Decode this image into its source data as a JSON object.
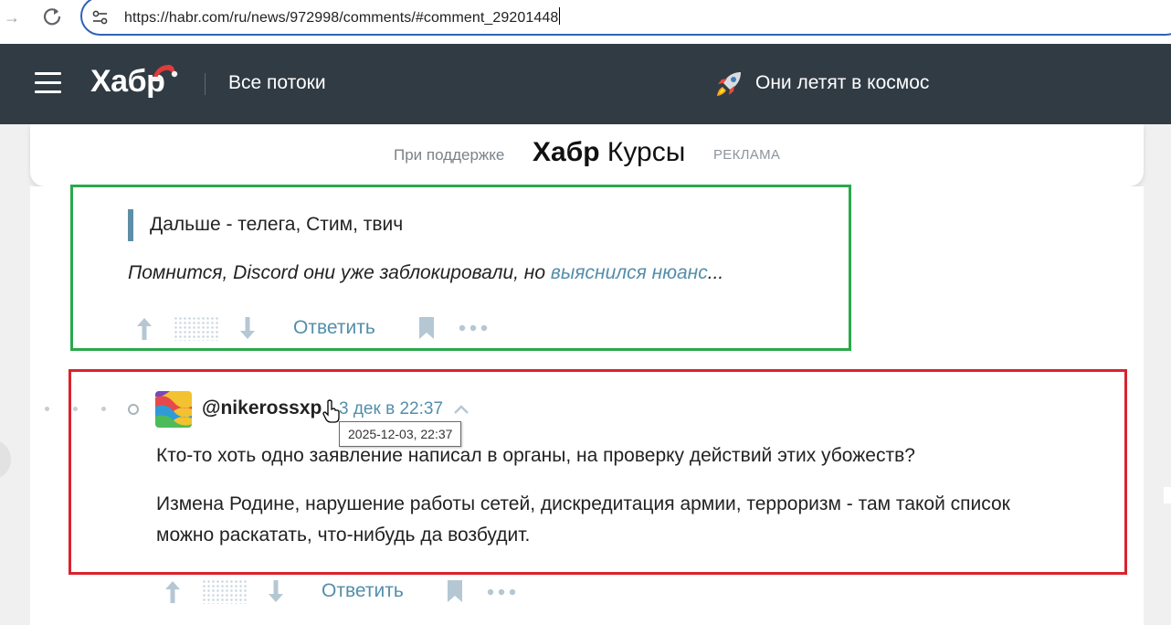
{
  "browser": {
    "url": "https://habr.com/ru/news/972998/comments/#comment_29201448"
  },
  "header": {
    "logo": "Хабр",
    "all_streams": "Все потоки",
    "promo_title": "Они летят в космос"
  },
  "sponsor": {
    "lead": "При поддержке",
    "brand_bold": "Хабр",
    "brand_regular": "Курсы",
    "ad_label": "РЕКЛАМА"
  },
  "comment1": {
    "quote": "Дальше - телега, Стим, твич",
    "text_before_link": "Помнится, Discord они уже заблокировали, но ",
    "link_text": "выяснился нюанс",
    "text_after_link": "...",
    "reply_label": "Ответить"
  },
  "comment2": {
    "username": "@nikerossxp",
    "time": "3 дек в 22:37",
    "tooltip": "2025-12-03, 22:37",
    "paragraph1": "Кто-то хоть одно заявление написал в органы, на проверку действий этих убожеств?",
    "paragraph2_line1": "Измена Родине, нарушение работы сетей, дискредитация армии, терроризм - там такой список",
    "paragraph2_line2": "можно раскатать, что-нибудь да возбудит.",
    "reply_label": "Ответить"
  },
  "colors": {
    "header_bg": "#303b44",
    "link": "#548eaa",
    "green_frame": "#2aa84a",
    "red_frame": "#d9232e"
  }
}
